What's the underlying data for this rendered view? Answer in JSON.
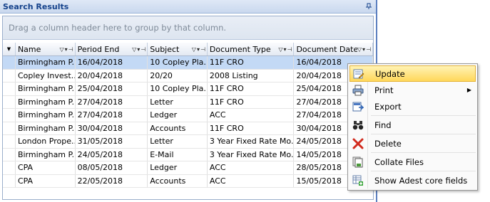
{
  "panel": {
    "title": "Search Results"
  },
  "grid": {
    "group_hint": "Drag a column header here to group by that column.",
    "columns": [
      "Name",
      "Period End",
      "Subject",
      "Document Type",
      "Document Date"
    ],
    "rows": [
      [
        "Birmingham P...",
        "16/04/2018",
        "10 Copley Pla...",
        "11F CRO",
        "16/04/2018"
      ],
      [
        "Copley Invest...",
        "20/04/2018",
        "20/20",
        "2008 Listing",
        "20/04/2018"
      ],
      [
        "Birmingham P...",
        "25/04/2018",
        "10 Copley Pla...",
        "11F CRO",
        "25/04/2018"
      ],
      [
        "Birmingham P...",
        "27/04/2018",
        "Letter",
        "11F CRO",
        "27/04/2018"
      ],
      [
        "Birmingham P...",
        "27/04/2018",
        "Ledger",
        "ACC",
        "27/04/2018"
      ],
      [
        "Birmingham P...",
        "30/04/2018",
        "Accounts",
        "11F CRO",
        "30/04/2018"
      ],
      [
        "London Prope...",
        "31/05/2018",
        "Letter",
        "3 Year Fixed Rate Mo...",
        "24/05/2018"
      ],
      [
        "Birmingham P...",
        "24/05/2018",
        "E-Mail",
        "3 Year Fixed Rate Mo...",
        "14/05/2018"
      ],
      [
        "CPA",
        "08/05/2018",
        "Ledger",
        "ACC",
        "28/05/2018"
      ],
      [
        "CPA",
        "22/05/2018",
        "Accounts",
        "ACC",
        "15/05/2018"
      ]
    ],
    "selected_row": 0
  },
  "context_menu": {
    "items": [
      {
        "label": "Update",
        "icon": "update-icon",
        "highlighted": true
      },
      {
        "label": "Print",
        "icon": "printer-icon",
        "submenu": true
      },
      {
        "label": "Export",
        "icon": "export-icon"
      },
      {
        "label": "Find",
        "icon": "binoculars-icon"
      },
      {
        "label": "Delete",
        "icon": "delete-x-icon"
      },
      {
        "label": "Collate Files",
        "icon": "collate-icon"
      },
      {
        "label": "Show Adest core fields",
        "icon": "add-fields-icon"
      }
    ]
  },
  "colors": {
    "title_text": "#15428b",
    "selection": "#c3d9f5",
    "menu_highlight": "#ffd75a"
  }
}
